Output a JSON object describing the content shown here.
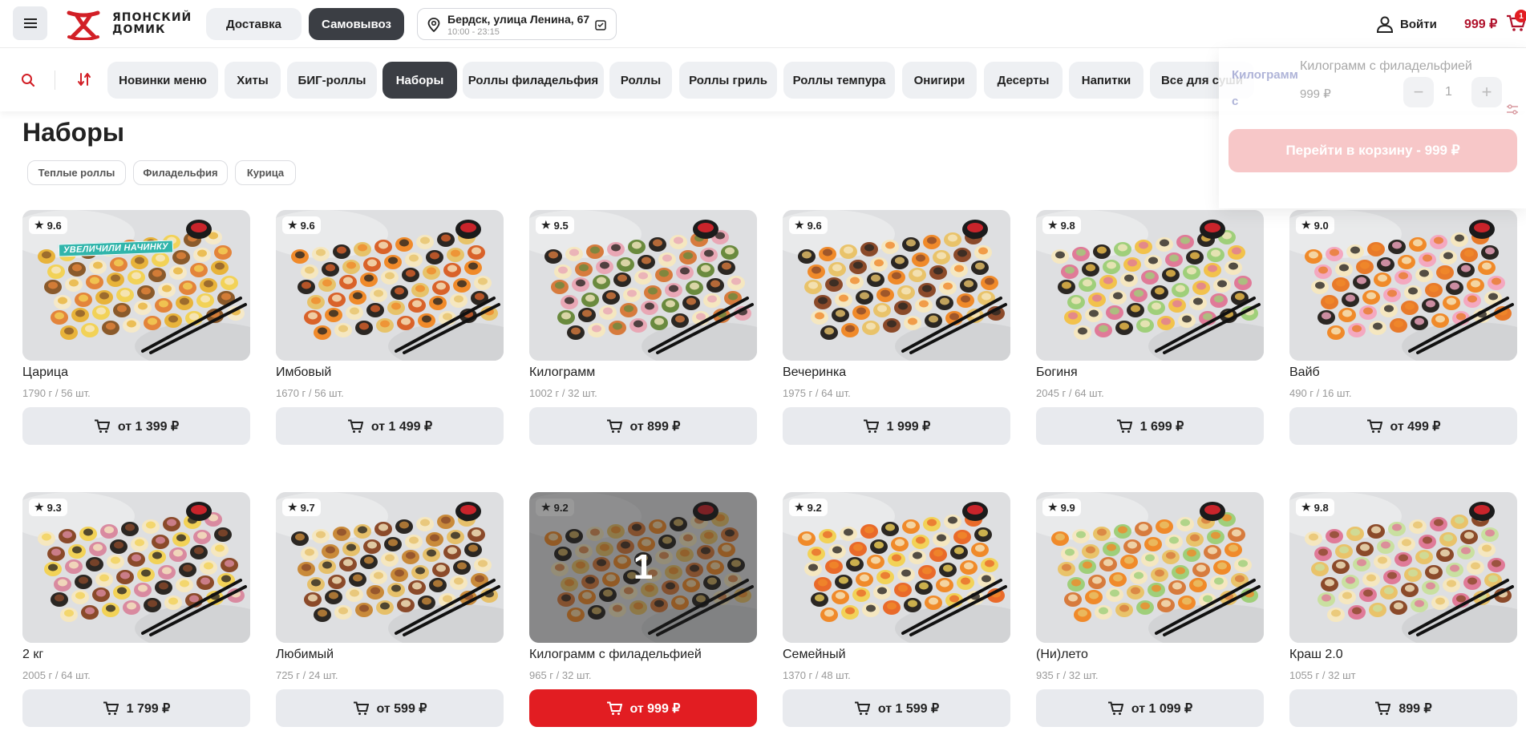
{
  "header": {
    "logo_text_1": "ЯПОНСКИЙ",
    "logo_text_2": "ДОМИК",
    "delivery_label": "Доставка",
    "pickup_label": "Самовывоз",
    "address": "Бердск, улица Ленина, 67",
    "hours": "10:00 - 23:15",
    "login_label": "Войти",
    "cart_total": "999 ₽",
    "cart_count": "1"
  },
  "categories": [
    {
      "label": "Новинки меню",
      "active": false
    },
    {
      "label": "Хиты",
      "active": false
    },
    {
      "label": "БИГ-роллы",
      "active": false
    },
    {
      "label": "Наборы",
      "active": true
    },
    {
      "label": "Роллы филадельфия",
      "active": false
    },
    {
      "label": "Роллы",
      "active": false
    },
    {
      "label": "Роллы гриль",
      "active": false
    },
    {
      "label": "Роллы темпура",
      "active": false
    },
    {
      "label": "Онигири",
      "active": false
    },
    {
      "label": "Десерты",
      "active": false
    },
    {
      "label": "Напитки",
      "active": false
    },
    {
      "label": "Все для суши",
      "active": false
    }
  ],
  "section": {
    "title": "Наборы",
    "tags": [
      "Теплые роллы",
      "Филадельфия",
      "Курица"
    ]
  },
  "products": [
    {
      "name": "Царица",
      "weight": "1790 г / 56 шт.",
      "price": "от 1 399 ₽",
      "rating": "9.6",
      "promo": "УВЕЛИЧИЛИ НАЧИНКУ"
    },
    {
      "name": "Имбовый",
      "weight": "1670 г / 56 шт.",
      "price": "от 1 499 ₽",
      "rating": "9.6"
    },
    {
      "name": "Килограмм",
      "weight": "1002 г / 32 шт.",
      "price": "от 899 ₽",
      "rating": "9.5"
    },
    {
      "name": "Вечеринка",
      "weight": "1975 г / 64 шт.",
      "price": "1 999 ₽",
      "rating": "9.6"
    },
    {
      "name": "Богиня",
      "weight": "2045 г / 64 шт.",
      "price": "1 699 ₽",
      "rating": "9.8"
    },
    {
      "name": "Вайб",
      "weight": "490 г / 16 шт.",
      "price": "от 499 ₽",
      "rating": "9.0"
    },
    {
      "name": "2 кг",
      "weight": "2005 г / 64 шт.",
      "price": "1 799 ₽",
      "rating": "9.3"
    },
    {
      "name": "Любимый",
      "weight": "725 г / 24 шт.",
      "price": "от 599 ₽",
      "rating": "9.7"
    },
    {
      "name": "Килограмм с филадельфией",
      "weight": "965 г / 32 шт.",
      "price": "от 999 ₽",
      "rating": "9.2",
      "in_cart": "1"
    },
    {
      "name": "Семейный",
      "weight": "1370 г / 48 шт.",
      "price": "от 1 599 ₽",
      "rating": "9.2"
    },
    {
      "name": "(Ни)лето",
      "weight": "935 г / 32 шт.",
      "price": "от 1 099 ₽",
      "rating": "9.9"
    },
    {
      "name": "Краш 2.0",
      "weight": "1055 г / 32 шт",
      "price": "899 ₽",
      "rating": "9.8"
    }
  ],
  "cart_popup": {
    "side_name": "Килограмм с филадельфией",
    "item_name": "Килограмм с филадельфией",
    "item_price": "999 ₽",
    "quantity": "1",
    "minus": "−",
    "plus": "+",
    "go_cart_label": "Перейти в корзину - 999 ₽"
  },
  "colors": {
    "accent_red": "#e21d22",
    "dark_chip": "#3b3e44",
    "cart_total": "#b0112b"
  }
}
